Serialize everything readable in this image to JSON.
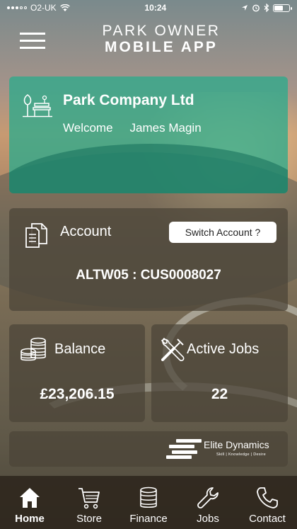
{
  "status_bar": {
    "carrier": "O2-UK",
    "time": "10:24"
  },
  "header": {
    "title_line1": "PARK OWNER",
    "title_line2": "MOBILE APP",
    "menu_icon": "hamburger-menu-icon"
  },
  "welcome_card": {
    "icon": "park-bench-icon",
    "company_name": "Park Company Ltd",
    "welcome_label": "Welcome",
    "user_name": "James Magin",
    "accent_color": "#2eaa8c"
  },
  "account_card": {
    "icon": "documents-icon",
    "label": "Account",
    "switch_button_label": "Switch Account ?",
    "account_code": "ALTW05 : CUS0008027"
  },
  "balance_card": {
    "icon": "coins-icon",
    "label": "Balance",
    "value": "£23,206.15"
  },
  "jobs_card": {
    "icon": "tools-icon",
    "label": "Active Jobs",
    "value": "22"
  },
  "footer_brand": {
    "name": "Elite Dynamics",
    "tagline": "Skill | Knowledge | Desire"
  },
  "bottom_nav": {
    "items": [
      {
        "label": "Home",
        "icon": "home-icon",
        "active": true
      },
      {
        "label": "Store",
        "icon": "cart-icon",
        "active": false
      },
      {
        "label": "Finance",
        "icon": "coins-icon",
        "active": false
      },
      {
        "label": "Jobs",
        "icon": "wrench-icon",
        "active": false
      },
      {
        "label": "Contact",
        "icon": "phone-icon",
        "active": false
      }
    ]
  }
}
